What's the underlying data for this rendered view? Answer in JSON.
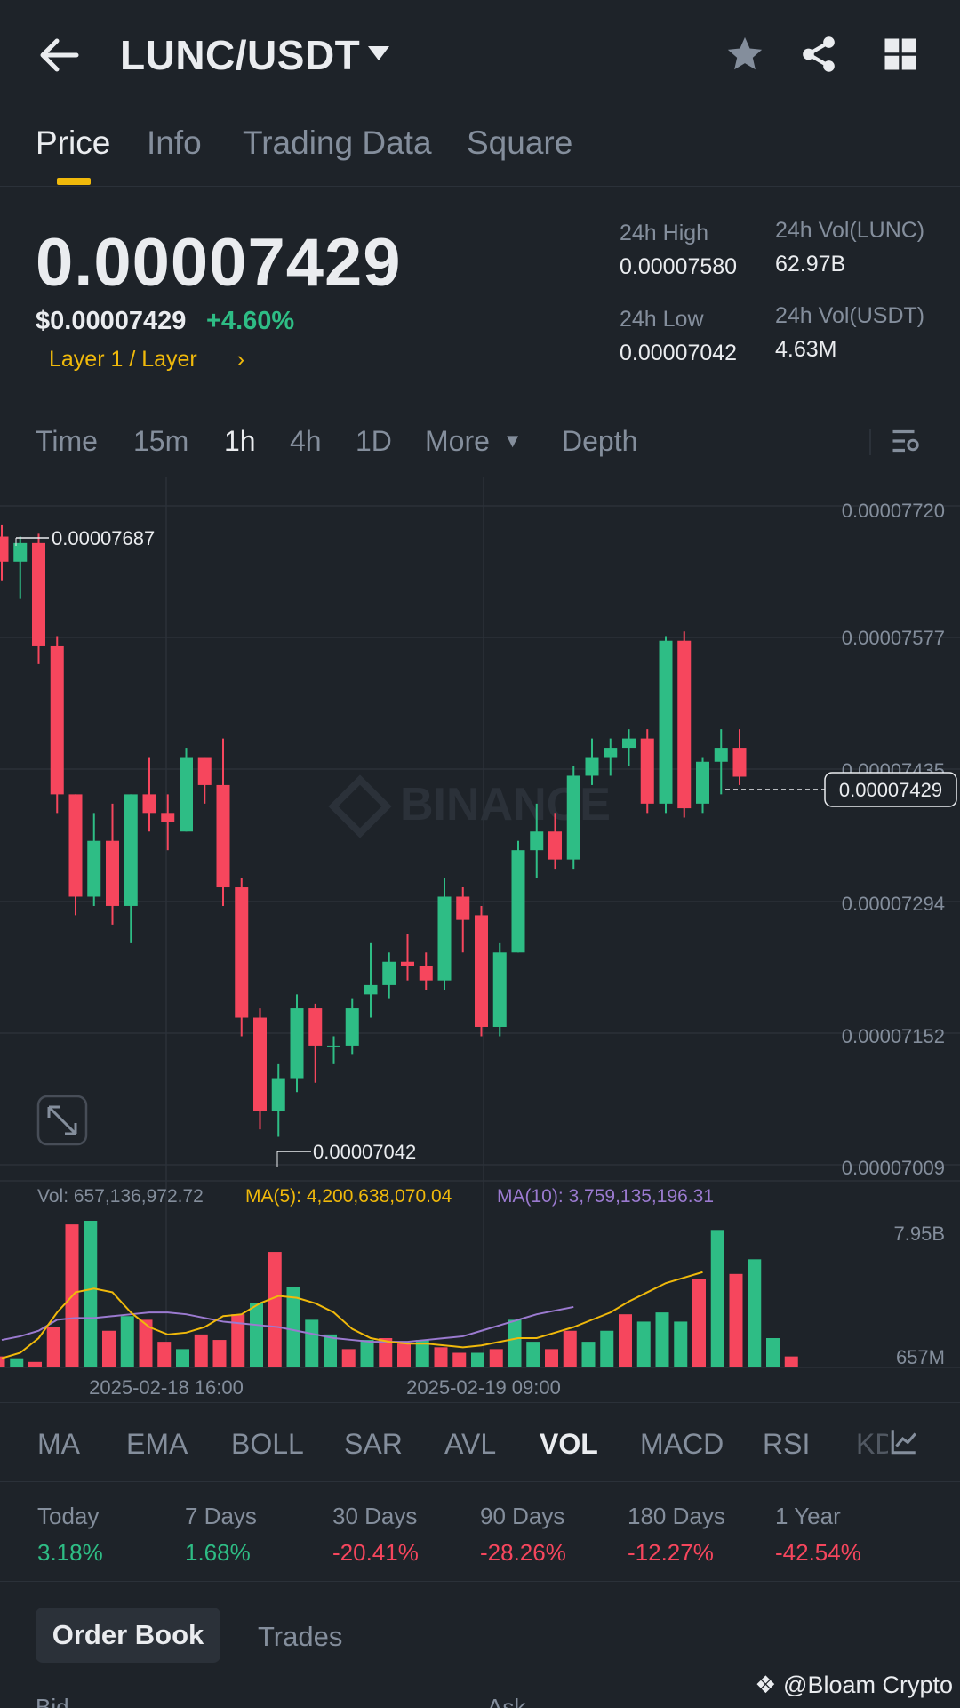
{
  "header": {
    "pair": "LUNC/USDT",
    "icons": [
      "back-arrow-icon",
      "caret-down-icon",
      "star-icon",
      "share-icon",
      "grid-icon"
    ]
  },
  "tabs": [
    "Price",
    "Info",
    "Trading Data",
    "Square"
  ],
  "price": {
    "last": "0.00007429",
    "usd": "$0.00007429",
    "change": "+4.60%",
    "category": "Layer 1 / Layer"
  },
  "stats": {
    "high_label": "24h High",
    "high_value": "0.00007580",
    "vol_base_label": "24h Vol(LUNC)",
    "vol_base_value": "62.97B",
    "low_label": "24h Low",
    "low_value": "0.00007042",
    "vol_quote_label": "24h Vol(USDT)",
    "vol_quote_value": "4.63M"
  },
  "timeframes": [
    "Time",
    "15m",
    "1h",
    "4h",
    "1D",
    "More",
    "Depth"
  ],
  "chart": {
    "y_axis": [
      "0.00007720",
      "0.00007577",
      "0.00007435",
      "0.00007294",
      "0.00007152",
      "0.00007009"
    ],
    "high_marker": "0.00007687",
    "low_marker": "0.00007042",
    "current": "0.00007429",
    "watermark": "BINANCE",
    "vol_label": "Vol: 657,136,972.72",
    "ma5_label": "MA(5): 4,200,638,070.04",
    "ma10_label": "MA(10): 3,759,135,196.31",
    "vol_axis": [
      "7.95B",
      "657M"
    ],
    "x_axis": [
      "2025-02-18 16:00",
      "2025-02-19 09:00"
    ],
    "colors": {
      "up": "#2ebd85",
      "down": "#f6465d",
      "ma5": "#f0b90b",
      "ma10": "#9b7ad0"
    }
  },
  "chart_data": {
    "type": "candlestick",
    "ylim": [
      7.009e-05,
      7.72e-05
    ],
    "candles": [
      {
        "o": 7.687e-05,
        "h": 7.7e-05,
        "l": 7.64e-05,
        "c": 7.66e-05
      },
      {
        "o": 7.66e-05,
        "h": 7.687e-05,
        "l": 7.62e-05,
        "c": 7.68e-05
      },
      {
        "o": 7.68e-05,
        "h": 7.69e-05,
        "l": 7.55e-05,
        "c": 7.57e-05
      },
      {
        "o": 7.57e-05,
        "h": 7.58e-05,
        "l": 7.39e-05,
        "c": 7.41e-05
      },
      {
        "o": 7.41e-05,
        "h": 7.41e-05,
        "l": 7.28e-05,
        "c": 7.3e-05
      },
      {
        "o": 7.3e-05,
        "h": 7.39e-05,
        "l": 7.29e-05,
        "c": 7.36e-05
      },
      {
        "o": 7.36e-05,
        "h": 7.4e-05,
        "l": 7.27e-05,
        "c": 7.29e-05
      },
      {
        "o": 7.29e-05,
        "h": 7.41e-05,
        "l": 7.25e-05,
        "c": 7.41e-05
      },
      {
        "o": 7.41e-05,
        "h": 7.45e-05,
        "l": 7.37e-05,
        "c": 7.39e-05
      },
      {
        "o": 7.39e-05,
        "h": 7.41e-05,
        "l": 7.35e-05,
        "c": 7.38e-05
      },
      {
        "o": 7.37e-05,
        "h": 7.46e-05,
        "l": 7.37e-05,
        "c": 7.45e-05
      },
      {
        "o": 7.45e-05,
        "h": 7.45e-05,
        "l": 7.4e-05,
        "c": 7.42e-05
      },
      {
        "o": 7.42e-05,
        "h": 7.47e-05,
        "l": 7.29e-05,
        "c": 7.31e-05
      },
      {
        "o": 7.31e-05,
        "h": 7.32e-05,
        "l": 7.15e-05,
        "c": 7.17e-05
      },
      {
        "o": 7.17e-05,
        "h": 7.18e-05,
        "l": 7.05e-05,
        "c": 7.07e-05
      },
      {
        "o": 7.07e-05,
        "h": 7.12e-05,
        "l": 7.042e-05,
        "c": 7.105e-05
      },
      {
        "o": 7.105e-05,
        "h": 7.195e-05,
        "l": 7.09e-05,
        "c": 7.18e-05
      },
      {
        "o": 7.18e-05,
        "h": 7.185e-05,
        "l": 7.1e-05,
        "c": 7.14e-05
      },
      {
        "o": 7.14e-05,
        "h": 7.15e-05,
        "l": 7.12e-05,
        "c": 7.14e-05
      },
      {
        "o": 7.14e-05,
        "h": 7.19e-05,
        "l": 7.13e-05,
        "c": 7.18e-05
      },
      {
        "o": 7.195e-05,
        "h": 7.25e-05,
        "l": 7.17e-05,
        "c": 7.205e-05
      },
      {
        "o": 7.205e-05,
        "h": 7.24e-05,
        "l": 7.19e-05,
        "c": 7.23e-05
      },
      {
        "o": 7.23e-05,
        "h": 7.26e-05,
        "l": 7.21e-05,
        "c": 7.225e-05
      },
      {
        "o": 7.225e-05,
        "h": 7.24e-05,
        "l": 7.2e-05,
        "c": 7.21e-05
      },
      {
        "o": 7.21e-05,
        "h": 7.32e-05,
        "l": 7.2e-05,
        "c": 7.3e-05
      },
      {
        "o": 7.3e-05,
        "h": 7.31e-05,
        "l": 7.24e-05,
        "c": 7.275e-05
      },
      {
        "o": 7.28e-05,
        "h": 7.29e-05,
        "l": 7.15e-05,
        "c": 7.16e-05
      },
      {
        "o": 7.16e-05,
        "h": 7.25e-05,
        "l": 7.15e-05,
        "c": 7.24e-05
      },
      {
        "o": 7.24e-05,
        "h": 7.36e-05,
        "l": 7.24e-05,
        "c": 7.35e-05
      },
      {
        "o": 7.35e-05,
        "h": 7.4e-05,
        "l": 7.32e-05,
        "c": 7.37e-05
      },
      {
        "o": 7.37e-05,
        "h": 7.39e-05,
        "l": 7.33e-05,
        "c": 7.34e-05
      },
      {
        "o": 7.34e-05,
        "h": 7.44e-05,
        "l": 7.33e-05,
        "c": 7.43e-05
      },
      {
        "o": 7.43e-05,
        "h": 7.47e-05,
        "l": 7.42e-05,
        "c": 7.45e-05
      },
      {
        "o": 7.45e-05,
        "h": 7.47e-05,
        "l": 7.43e-05,
        "c": 7.46e-05
      },
      {
        "o": 7.46e-05,
        "h": 7.48e-05,
        "l": 7.44e-05,
        "c": 7.47e-05
      },
      {
        "o": 7.47e-05,
        "h": 7.48e-05,
        "l": 7.39e-05,
        "c": 7.4e-05
      },
      {
        "o": 7.4e-05,
        "h": 7.58e-05,
        "l": 7.39e-05,
        "c": 7.575e-05
      },
      {
        "o": 7.575e-05,
        "h": 7.585e-05,
        "l": 7.385e-05,
        "c": 7.395e-05
      },
      {
        "o": 7.4e-05,
        "h": 7.45e-05,
        "l": 7.39e-05,
        "c": 7.445e-05
      },
      {
        "o": 7.445e-05,
        "h": 7.48e-05,
        "l": 7.41e-05,
        "c": 7.46e-05
      },
      {
        "o": 7.46e-05,
        "h": 7.48e-05,
        "l": 7.42e-05,
        "c": 7.429e-05
      }
    ],
    "volume": [
      0.6,
      0.5,
      0.3,
      2.2,
      7.8,
      8.0,
      2.0,
      2.8,
      2.6,
      1.4,
      1.0,
      1.8,
      1.5,
      2.9,
      3.5,
      6.3,
      4.4,
      2.6,
      1.8,
      1.0,
      1.5,
      1.6,
      1.3,
      1.5,
      1.1,
      0.8,
      0.8,
      1.0,
      2.6,
      1.4,
      1.0,
      2.0,
      1.4,
      2.0,
      2.9,
      2.5,
      3.0,
      2.5,
      4.8,
      7.5,
      5.1,
      5.9,
      1.6,
      0.6
    ],
    "volume_up": [
      false,
      true,
      false,
      false,
      false,
      true,
      false,
      true,
      false,
      false,
      true,
      false,
      false,
      false,
      true,
      false,
      true,
      true,
      true,
      false,
      true,
      false,
      false,
      true,
      false,
      false,
      true,
      false,
      true,
      true,
      false,
      false,
      true,
      true,
      false,
      true,
      true,
      true,
      false,
      true,
      false,
      true,
      true,
      false
    ],
    "ma5": [
      0.5,
      0.8,
      1.6,
      3.0,
      4.1,
      4.3,
      4.1,
      3.0,
      2.2,
      1.8,
      1.9,
      2.2,
      2.8,
      2.9,
      3.5,
      3.9,
      3.8,
      3.5,
      3.0,
      2.1,
      1.6,
      1.4,
      1.3,
      1.3,
      1.2,
      1.1,
      1.2,
      1.4,
      1.6,
      1.6,
      1.9,
      2.2,
      2.6,
      3.0,
      3.6,
      4.1,
      4.6,
      4.9,
      5.2
    ],
    "ma10": [
      1.5,
      1.7,
      2.0,
      2.6,
      2.7,
      2.7,
      2.8,
      2.9,
      3.0,
      3.0,
      2.9,
      2.7,
      2.5,
      2.4,
      2.3,
      2.2,
      2.0,
      1.8,
      1.6,
      1.5,
      1.4,
      1.4,
      1.4,
      1.5,
      1.6,
      1.7,
      2.0,
      2.3,
      2.6,
      2.9,
      3.1,
      3.3
    ]
  },
  "indicators": [
    "MA",
    "EMA",
    "BOLL",
    "SAR",
    "AVL",
    "VOL",
    "MACD",
    "RSI",
    "KD"
  ],
  "performance": [
    {
      "label": "Today",
      "value": "3.18%",
      "dir": "pos"
    },
    {
      "label": "7 Days",
      "value": "1.68%",
      "dir": "pos"
    },
    {
      "label": "30 Days",
      "value": "-20.41%",
      "dir": "neg"
    },
    {
      "label": "90 Days",
      "value": "-28.26%",
      "dir": "neg"
    },
    {
      "label": "180 Days",
      "value": "-12.27%",
      "dir": "neg"
    },
    {
      "label": "1 Year",
      "value": "-42.54%",
      "dir": "neg"
    }
  ],
  "bottom_tabs": [
    "Order Book",
    "Trades"
  ],
  "orderbook_head": [
    "Bid",
    "Ask"
  ],
  "watermark_credit": "@Bloam Crypto"
}
